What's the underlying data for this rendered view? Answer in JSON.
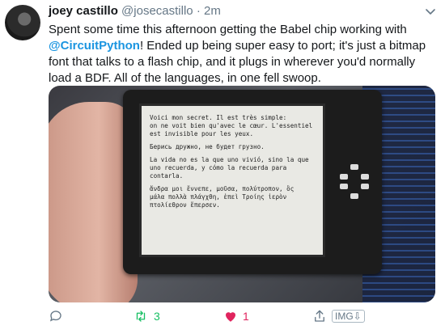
{
  "tweet": {
    "name": "joey castillo",
    "handle": "@josecastillo",
    "separator": "·",
    "time": "2m",
    "text_before": "Spent some time this afternoon getting the Babel chip working with ",
    "mention": "@CircuitPython",
    "text_after": "! Ended up being super easy to port; it's just a bitmap font that talks to a flash chip, and it plugs in wherever you'd normally load a BDF. All of the languages, in one fell swoop."
  },
  "screen": {
    "para1": "Voici mon secret. Il est très simple:\non ne voit bien qu'avec le cœur. L'essentiel\nest invisible pour les yeux.",
    "para2": "Берись дружно, не будет грузно.",
    "para3": "La vida no es la que uno vivió, sino la que\nuno recuerda, y cómo la recuerda para contarla.",
    "para4": "ἄνδρα μοι ἔννεπε, μοῦσα, πολύτροπον, ὃς\nμάλα πολλὰ πλάγχθη, ἐπεὶ Τροίης ἱερὸν\nπτολίεθρον ἔπερσεν."
  },
  "footer": {
    "retweet_count": "3",
    "like_count": "1",
    "img_label": "IMG⇩"
  },
  "colors": {
    "mention": "#1b95e0",
    "retweet": "#17bf63",
    "like": "#e0245e",
    "muted": "#657786"
  }
}
